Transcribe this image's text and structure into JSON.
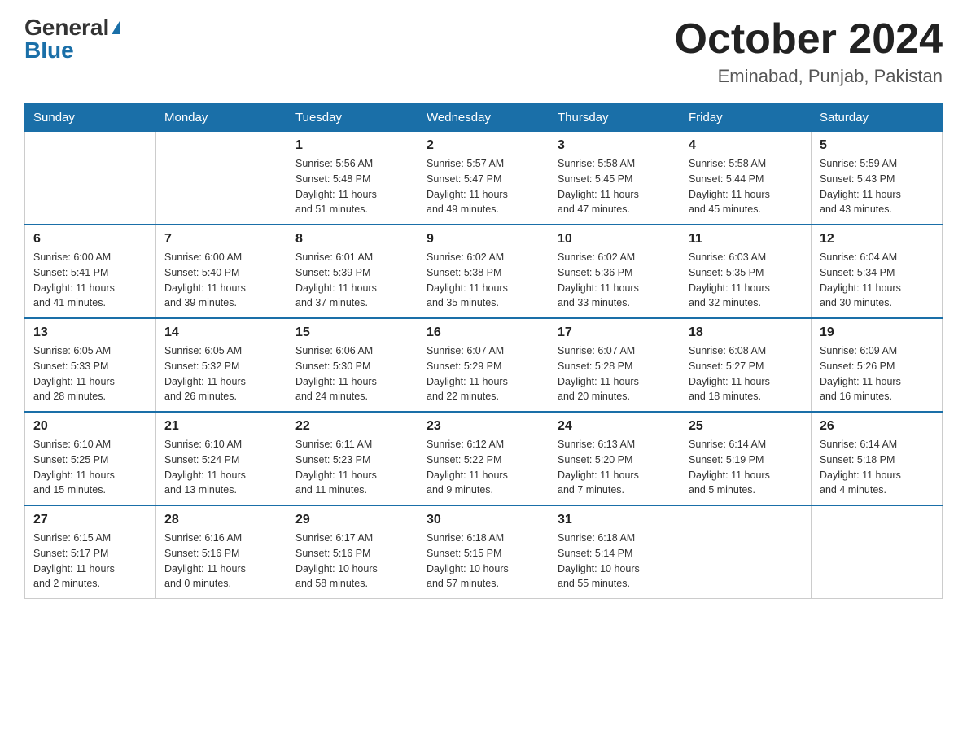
{
  "header": {
    "logo_general": "General",
    "logo_blue": "Blue",
    "month_title": "October 2024",
    "location": "Eminabad, Punjab, Pakistan"
  },
  "days_of_week": [
    "Sunday",
    "Monday",
    "Tuesday",
    "Wednesday",
    "Thursday",
    "Friday",
    "Saturday"
  ],
  "weeks": [
    [
      {
        "day": "",
        "info": ""
      },
      {
        "day": "",
        "info": ""
      },
      {
        "day": "1",
        "info": "Sunrise: 5:56 AM\nSunset: 5:48 PM\nDaylight: 11 hours\nand 51 minutes."
      },
      {
        "day": "2",
        "info": "Sunrise: 5:57 AM\nSunset: 5:47 PM\nDaylight: 11 hours\nand 49 minutes."
      },
      {
        "day": "3",
        "info": "Sunrise: 5:58 AM\nSunset: 5:45 PM\nDaylight: 11 hours\nand 47 minutes."
      },
      {
        "day": "4",
        "info": "Sunrise: 5:58 AM\nSunset: 5:44 PM\nDaylight: 11 hours\nand 45 minutes."
      },
      {
        "day": "5",
        "info": "Sunrise: 5:59 AM\nSunset: 5:43 PM\nDaylight: 11 hours\nand 43 minutes."
      }
    ],
    [
      {
        "day": "6",
        "info": "Sunrise: 6:00 AM\nSunset: 5:41 PM\nDaylight: 11 hours\nand 41 minutes."
      },
      {
        "day": "7",
        "info": "Sunrise: 6:00 AM\nSunset: 5:40 PM\nDaylight: 11 hours\nand 39 minutes."
      },
      {
        "day": "8",
        "info": "Sunrise: 6:01 AM\nSunset: 5:39 PM\nDaylight: 11 hours\nand 37 minutes."
      },
      {
        "day": "9",
        "info": "Sunrise: 6:02 AM\nSunset: 5:38 PM\nDaylight: 11 hours\nand 35 minutes."
      },
      {
        "day": "10",
        "info": "Sunrise: 6:02 AM\nSunset: 5:36 PM\nDaylight: 11 hours\nand 33 minutes."
      },
      {
        "day": "11",
        "info": "Sunrise: 6:03 AM\nSunset: 5:35 PM\nDaylight: 11 hours\nand 32 minutes."
      },
      {
        "day": "12",
        "info": "Sunrise: 6:04 AM\nSunset: 5:34 PM\nDaylight: 11 hours\nand 30 minutes."
      }
    ],
    [
      {
        "day": "13",
        "info": "Sunrise: 6:05 AM\nSunset: 5:33 PM\nDaylight: 11 hours\nand 28 minutes."
      },
      {
        "day": "14",
        "info": "Sunrise: 6:05 AM\nSunset: 5:32 PM\nDaylight: 11 hours\nand 26 minutes."
      },
      {
        "day": "15",
        "info": "Sunrise: 6:06 AM\nSunset: 5:30 PM\nDaylight: 11 hours\nand 24 minutes."
      },
      {
        "day": "16",
        "info": "Sunrise: 6:07 AM\nSunset: 5:29 PM\nDaylight: 11 hours\nand 22 minutes."
      },
      {
        "day": "17",
        "info": "Sunrise: 6:07 AM\nSunset: 5:28 PM\nDaylight: 11 hours\nand 20 minutes."
      },
      {
        "day": "18",
        "info": "Sunrise: 6:08 AM\nSunset: 5:27 PM\nDaylight: 11 hours\nand 18 minutes."
      },
      {
        "day": "19",
        "info": "Sunrise: 6:09 AM\nSunset: 5:26 PM\nDaylight: 11 hours\nand 16 minutes."
      }
    ],
    [
      {
        "day": "20",
        "info": "Sunrise: 6:10 AM\nSunset: 5:25 PM\nDaylight: 11 hours\nand 15 minutes."
      },
      {
        "day": "21",
        "info": "Sunrise: 6:10 AM\nSunset: 5:24 PM\nDaylight: 11 hours\nand 13 minutes."
      },
      {
        "day": "22",
        "info": "Sunrise: 6:11 AM\nSunset: 5:23 PM\nDaylight: 11 hours\nand 11 minutes."
      },
      {
        "day": "23",
        "info": "Sunrise: 6:12 AM\nSunset: 5:22 PM\nDaylight: 11 hours\nand 9 minutes."
      },
      {
        "day": "24",
        "info": "Sunrise: 6:13 AM\nSunset: 5:20 PM\nDaylight: 11 hours\nand 7 minutes."
      },
      {
        "day": "25",
        "info": "Sunrise: 6:14 AM\nSunset: 5:19 PM\nDaylight: 11 hours\nand 5 minutes."
      },
      {
        "day": "26",
        "info": "Sunrise: 6:14 AM\nSunset: 5:18 PM\nDaylight: 11 hours\nand 4 minutes."
      }
    ],
    [
      {
        "day": "27",
        "info": "Sunrise: 6:15 AM\nSunset: 5:17 PM\nDaylight: 11 hours\nand 2 minutes."
      },
      {
        "day": "28",
        "info": "Sunrise: 6:16 AM\nSunset: 5:16 PM\nDaylight: 11 hours\nand 0 minutes."
      },
      {
        "day": "29",
        "info": "Sunrise: 6:17 AM\nSunset: 5:16 PM\nDaylight: 10 hours\nand 58 minutes."
      },
      {
        "day": "30",
        "info": "Sunrise: 6:18 AM\nSunset: 5:15 PM\nDaylight: 10 hours\nand 57 minutes."
      },
      {
        "day": "31",
        "info": "Sunrise: 6:18 AM\nSunset: 5:14 PM\nDaylight: 10 hours\nand 55 minutes."
      },
      {
        "day": "",
        "info": ""
      },
      {
        "day": "",
        "info": ""
      }
    ]
  ]
}
